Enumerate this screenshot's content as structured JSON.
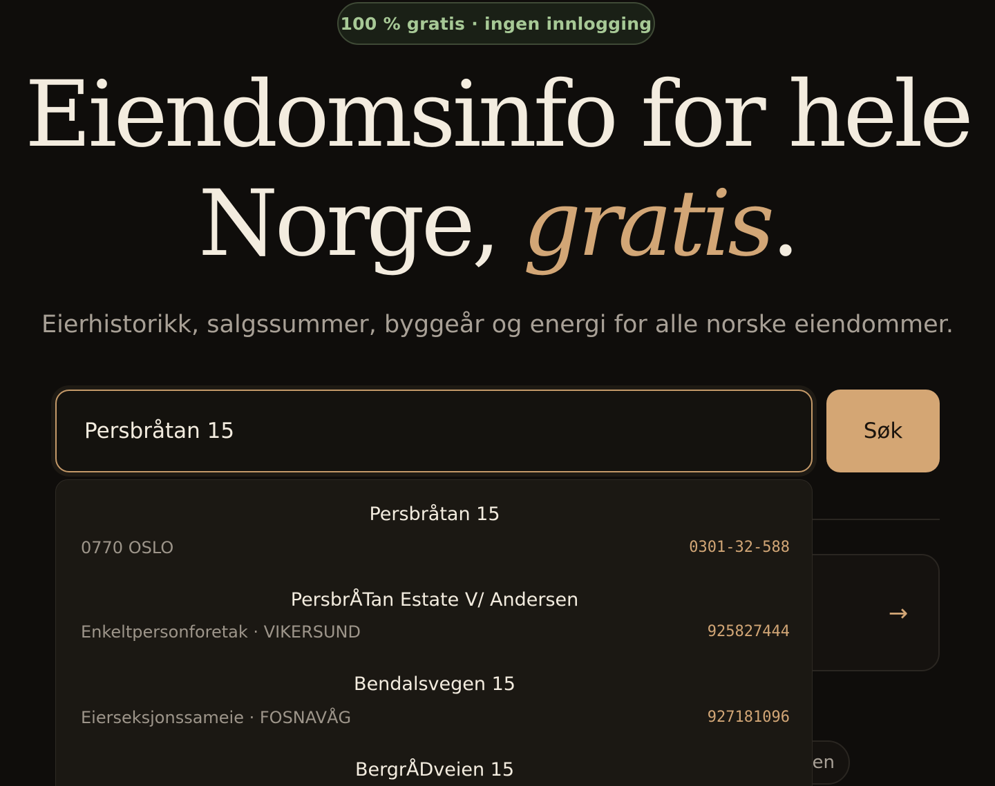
{
  "badge": {
    "label": "100 % gratis · ingen innlogging"
  },
  "hero": {
    "line1": "Eiendomsinfo for hele",
    "line2_prefix": "Norge,",
    "line2_accent": "gratis",
    "line2_suffix": "."
  },
  "subtitle": "Eierhistorikk, salgssummer, byggeår og energi for alle norske eiendommer.",
  "search": {
    "value": "Persbråtan 15",
    "button_label": "Søk"
  },
  "background": {
    "arrow_icon": "arrow-right-icon",
    "chip_text": "en"
  },
  "suggestions": [
    {
      "title": "Persbråtan 15",
      "subtitle": "0770 OSLO",
      "id": "0301-32-588"
    },
    {
      "title": "PersbrÅTan Estate V/ Andersen",
      "subtitle": "Enkeltpersonforetak · VIKERSUND",
      "id": "925827444"
    },
    {
      "title": "Bendalsvegen 15",
      "subtitle": "Eierseksjonssameie · FOSNAVÅG",
      "id": "927181096"
    },
    {
      "title": "BergrÅDveien 15",
      "subtitle": "",
      "id": ""
    }
  ],
  "colors": {
    "background": "#0f0d0b",
    "accent": "#d2a676",
    "badge_text": "#a7c996"
  }
}
